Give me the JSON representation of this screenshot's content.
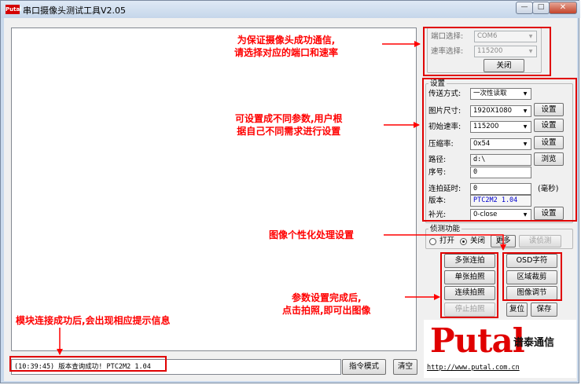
{
  "window": {
    "icon_text": "Putal",
    "title": "串口摄像头测试工具V2.05",
    "min_glyph": "—",
    "max_glyph": "□",
    "close_glyph": "✕"
  },
  "port_panel": {
    "port_label": "端口选择:",
    "port_value": "COM6",
    "baud_label": "速率选择:",
    "baud_value": "115200",
    "close_button": "关闭"
  },
  "settings": {
    "legend": "设置",
    "transfer_label": "传送方式:",
    "transfer_value": "一次性读取",
    "size_label": "图片尺寸:",
    "size_value": "1920X1080",
    "init_rate_label": "初始速率:",
    "init_rate_value": "115200",
    "compression_label": "压缩率:",
    "compression_value": "0x54",
    "path_label": "路径:",
    "path_value": "d:\\",
    "browse_button": "浏览",
    "seq_label": "序号:",
    "seq_value": "0",
    "delay_label": "连拍延时:",
    "delay_value": "0",
    "delay_unit": "(毫秒)",
    "version_label": "版本:",
    "version_value": "PTC2M2 1.04",
    "fill_light_label": "补光:",
    "fill_light_value": "0-close",
    "set_button": "设置"
  },
  "detect": {
    "legend": "侦测功能",
    "open_label": "打开",
    "close_label": "关闭",
    "more_button": "更多",
    "read_button": "读侦测"
  },
  "capture": {
    "multi_button": "多张连拍",
    "single_button": "单张拍照",
    "continuous_button": "连续拍照",
    "stop_button": "停止拍照",
    "osd_button": "OSD字符",
    "crop_button": "区域裁剪",
    "adjust_button": "图像调节",
    "reset_button": "复位",
    "save_button": "保存"
  },
  "bottom": {
    "log_text": "(10:39:45) 版本查询成功! PTC2M2 1.04",
    "command_mode_button": "指令模式",
    "clear_button": "清空"
  },
  "logo": {
    "brand": "Putal",
    "cn_name": "谱泰通信",
    "url": "http://www.putal.com.cn"
  },
  "annotations": {
    "a1_line1": "为保证摄像头成功通信,",
    "a1_line2": "请选择对应的端口和速率",
    "a2_line1": "可设置成不同参数,用户根",
    "a2_line2": "据自己不同需求进行设置",
    "a3": "图像个性化处理设置",
    "a4_line1": "参数设置完成后,",
    "a4_line2": "点击拍照,即可出图像",
    "a5": "模块连接成功后,会出现相应提示信息"
  },
  "colors": {
    "annotation": "#ff0000",
    "version_text": "#0000cc",
    "brand": "#e00000"
  }
}
